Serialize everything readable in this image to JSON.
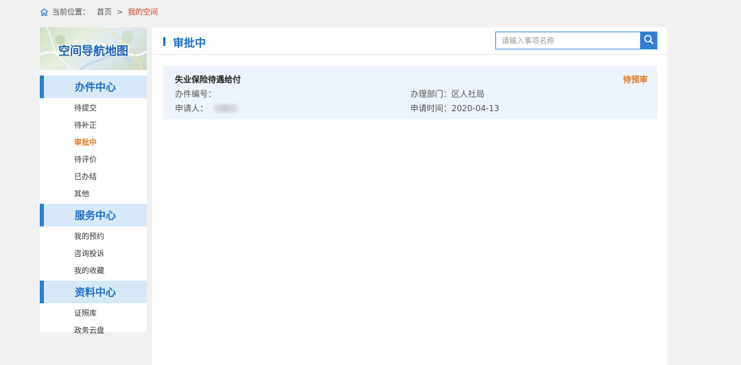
{
  "breadcrumb": {
    "label": "当前位置：",
    "items": [
      "首页",
      "我的空间"
    ],
    "separator": ">"
  },
  "sidebar": {
    "banner_title": "空间导航地图",
    "sections": [
      {
        "title": "办件中心",
        "items": [
          "待提交",
          "待补正",
          "审批中",
          "待评价",
          "已办结",
          "其他"
        ]
      },
      {
        "title": "服务中心",
        "items": [
          "我的预约",
          "咨询投诉",
          "我的收藏"
        ]
      },
      {
        "title": "资料中心",
        "items": [
          "证照库",
          "政务云盘"
        ]
      }
    ],
    "active_item": "审批中"
  },
  "main": {
    "title": "审批中",
    "search": {
      "placeholder": "请输入事项名称",
      "value": ""
    },
    "records": [
      {
        "name": "失业保险待遇给付",
        "status": "待预审",
        "number_label": "办件编号：",
        "number_value": "",
        "dept_label": "办理部门：",
        "dept_value": "区人社局",
        "applicant_label": "申请人：",
        "date_label": "申请时间：",
        "date_value": "2020-04-13"
      }
    ]
  },
  "colors": {
    "accent": "#1e6ec8",
    "active": "#e07a1f",
    "breadcrumb_current": "#d0401b",
    "section_bg": "#d7e9f9",
    "card_bg": "#eef4fb"
  },
  "icons": {
    "breadcrumb": "home-icon",
    "search": "search-icon"
  }
}
